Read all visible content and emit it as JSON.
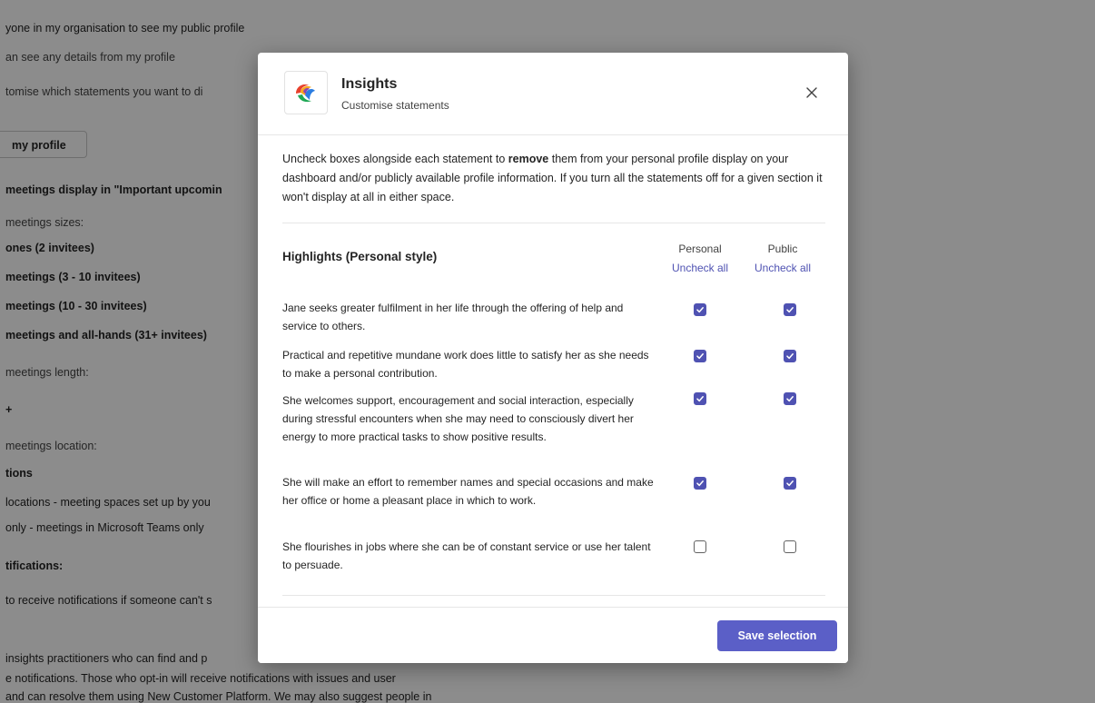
{
  "background": {
    "lines": [
      "yone in my organisation to see my public profile",
      "an see any details from my profile",
      "tomise which statements you want to di",
      "meetings display in \"Important upcomin",
      "meetings sizes:",
      "ones (2 invitees)",
      "meetings (3 - 10 invitees)",
      "meetings (10 - 30 invitees)",
      "meetings and all-hands (31+ invitees)",
      "meetings length:",
      "+",
      "meetings location:",
      "tions",
      "locations - meeting spaces set up by you",
      "only - meetings in Microsoft Teams only",
      "tifications:",
      "to receive notifications if someone can't s",
      "insights practitioners who can find and p",
      "e notifications. Those who opt-in will receive notifications with issues and user",
      "and can resolve them using New Customer Platform. We may also suggest people in"
    ],
    "button_label": "my profile"
  },
  "dialog": {
    "title": "Insights",
    "subtitle": "Customise statements",
    "close_icon": "close-icon",
    "intro_part1": "Uncheck boxes alongside each statement to ",
    "intro_bold": "remove",
    "intro_part2": " them from your personal profile display on your dashboard and/or publicly available profile information. If you turn all the statements off for a given section it won't display at all in either space.",
    "section_title": "Highlights (Personal style)",
    "col_personal": "Personal",
    "col_public": "Public",
    "uncheck_all_personal": "Uncheck all",
    "uncheck_all_public": "Uncheck all",
    "statements": [
      {
        "text": "Jane seeks greater fulfilment in her life through the offering of help and service to others.",
        "personal": true,
        "public": true
      },
      {
        "text": "Practical and repetitive mundane work does little to satisfy her as she needs to make a personal contribution.",
        "personal": true,
        "public": true
      },
      {
        "text": "She welcomes support, encouragement and social interaction, especially during stressful encounters when she may need to consciously divert her energy to more practical tasks to show positive results.",
        "personal": true,
        "public": true
      },
      {
        "text": "She will make an effort to remember names and special occasions and make her office or home a pleasant place in which to work.",
        "personal": true,
        "public": true
      },
      {
        "text": "She flourishes in jobs where she can be of constant service or use her talent to persuade.",
        "personal": false,
        "public": false
      }
    ],
    "save_label": "Save selection",
    "accent_color": "#5b5fc7"
  }
}
